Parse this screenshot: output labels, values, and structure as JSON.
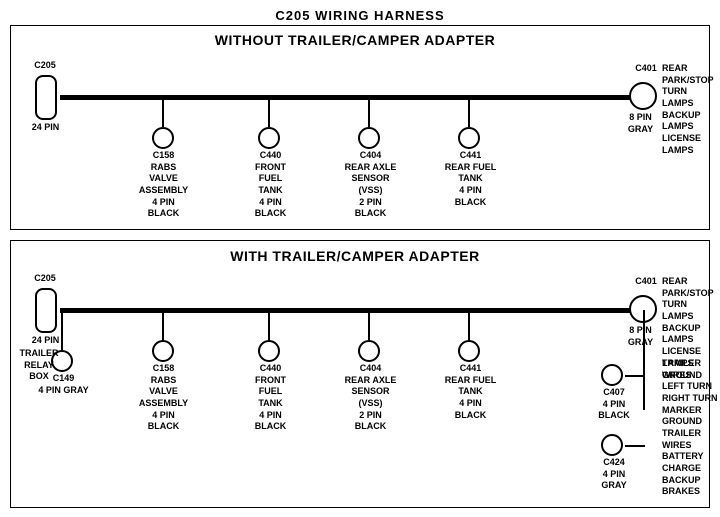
{
  "title": "C205 WIRING HARNESS",
  "section1": {
    "label": "WITHOUT  TRAILER/CAMPER  ADAPTER",
    "connectors": [
      {
        "id": "C205_1",
        "label": "C205",
        "sublabel": "24 PIN",
        "type": "rect"
      },
      {
        "id": "C158_1",
        "label": "C158",
        "sublabel": "RABS VALVE\nASSEMBLY\n4 PIN BLACK"
      },
      {
        "id": "C440_1",
        "label": "C440",
        "sublabel": "FRONT FUEL\nTANK\n4 PIN BLACK"
      },
      {
        "id": "C404_1",
        "label": "C404",
        "sublabel": "REAR AXLE\nSENSOR\n(VSS)\n2 PIN BLACK"
      },
      {
        "id": "C441_1",
        "label": "C441",
        "sublabel": "REAR FUEL\nTANK\n4 PIN BLACK"
      },
      {
        "id": "C401_1",
        "label": "C401",
        "sublabel": "8 PIN\nGRAY",
        "rightlabel": "REAR PARK/STOP\nTURN LAMPS\nBACKUP LAMPS\nLICENSE LAMPS"
      }
    ]
  },
  "section2": {
    "label": "WITH  TRAILER/CAMPER  ADAPTER",
    "connectors": [
      {
        "id": "C205_2",
        "label": "C205",
        "sublabel": "24 PIN",
        "type": "rect"
      },
      {
        "id": "C149",
        "label": "C149",
        "sublabel": "4 PIN GRAY",
        "extra": "TRAILER\nRELAY\nBOX"
      },
      {
        "id": "C158_2",
        "label": "C158",
        "sublabel": "RABS VALVE\nASSEMBLY\n4 PIN BLACK"
      },
      {
        "id": "C440_2",
        "label": "C440",
        "sublabel": "FRONT FUEL\nTANK\n4 PIN BLACK"
      },
      {
        "id": "C404_2",
        "label": "C404",
        "sublabel": "REAR AXLE\nSENSOR\n(VSS)\n2 PIN BLACK"
      },
      {
        "id": "C441_2",
        "label": "C441",
        "sublabel": "REAR FUEL\nTANK\n4 PIN BLACK"
      },
      {
        "id": "C401_2",
        "label": "C401",
        "sublabel": "8 PIN\nGRAY",
        "rightlabel": "REAR PARK/STOP\nTURN LAMPS\nBACKUP LAMPS\nLICENSE LAMPS\nGROUND"
      },
      {
        "id": "C407",
        "label": "C407",
        "sublabel": "4 PIN\nBLACK",
        "rightlabel": "TRAILER WIRES\nLEFT TURN\nRIGHT TURN\nMARKER\nGROUND"
      },
      {
        "id": "C424",
        "label": "C424",
        "sublabel": "4 PIN\nGRAY",
        "rightlabel": "TRAILER WIRES\nBATTERY CHARGE\nBACKUP\nBRAKES"
      }
    ]
  }
}
